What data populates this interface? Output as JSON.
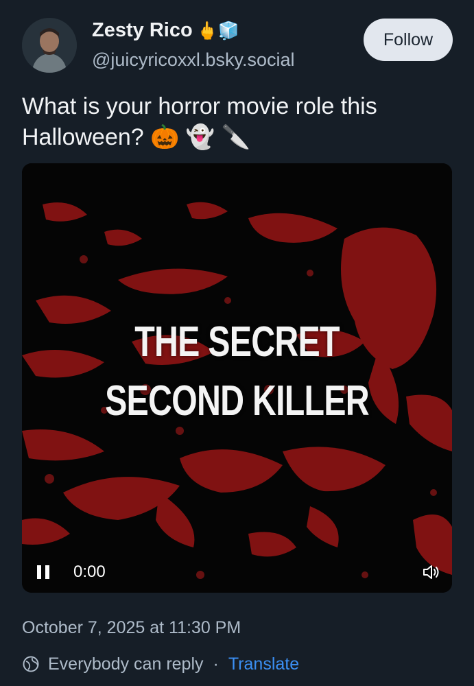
{
  "author": {
    "display_name": "Zesty Rico",
    "name_emoji": "🖕🧊",
    "handle": "@juicyricoxxl.bsky.social",
    "avatar_icon": "avatar-photo"
  },
  "follow_label": "Follow",
  "post": {
    "text": "What is your horror movie role this Halloween? 🎃 👻 🔪"
  },
  "video": {
    "title_line1": "THE SECRET",
    "title_line2": "SECOND KILLER",
    "time": "0:00",
    "play_state_icon": "pause-icon",
    "sound_icon": "speaker-icon"
  },
  "meta": {
    "timestamp": "October 7, 2025 at 11:30 PM",
    "reply_setting": "Everybody can reply",
    "separator": "·",
    "translate_label": "Translate"
  },
  "colors": {
    "background": "#161e27",
    "accent_link": "#3b8ff3",
    "blood_red": "#a01818",
    "muted_text": "#aebbc9"
  }
}
